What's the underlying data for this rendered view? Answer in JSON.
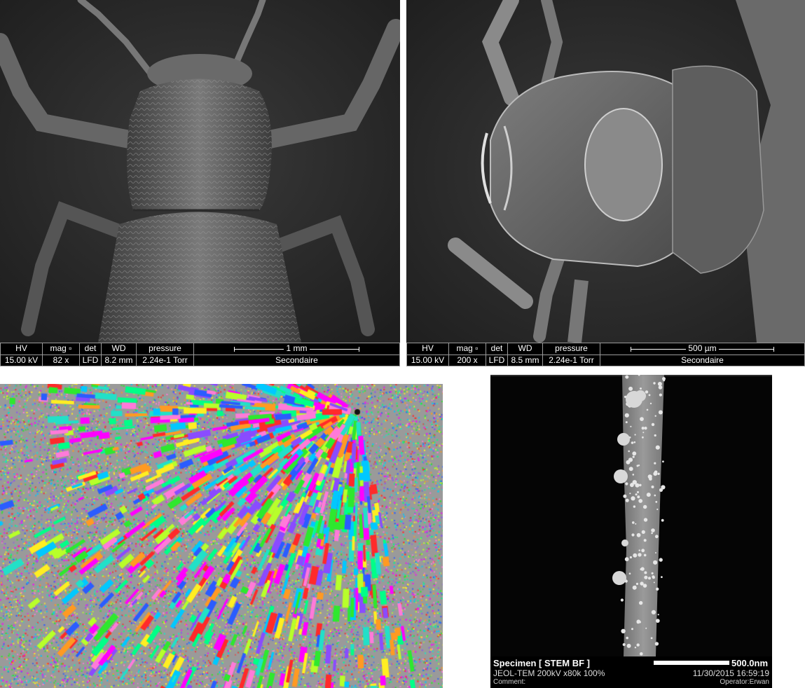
{
  "panels": {
    "sem1": {
      "databar": {
        "headers": [
          "HV",
          "mag",
          "det",
          "WD",
          "pressure"
        ],
        "values": [
          "15.00 kV",
          "82 x",
          "LFD",
          "8.2 mm",
          "2.24e-1 Torr"
        ],
        "scale_label": "1 mm",
        "mode": "Secondaire"
      }
    },
    "sem2": {
      "databar": {
        "headers": [
          "HV",
          "mag",
          "det",
          "WD",
          "pressure"
        ],
        "values": [
          "15.00 kV",
          "200 x",
          "LFD",
          "8.5 mm",
          "2.24e-1 Torr"
        ],
        "scale_label": "500 µm",
        "mode": "Secondaire"
      }
    },
    "ebsd": {},
    "stem": {
      "title": "Specimen [ STEM BF ]",
      "scale_label": "500.0nm",
      "instrument": "JEOL-TEM 200kV x80k 100%",
      "date": "11/30/2015 16:59:19",
      "comment_label": "Comment:",
      "operator": "Operator:Erwan"
    }
  },
  "colors": {
    "databar_bg": "#000000",
    "databar_text": "#ffffff",
    "sem_background": "#2a2a2a",
    "stem_background": "#050505"
  }
}
